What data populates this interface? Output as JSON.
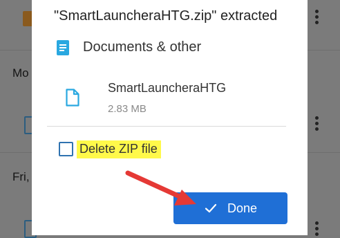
{
  "background": {
    "dates": [
      "Mo",
      "Fri,"
    ]
  },
  "dialog": {
    "title": "\"SmartLauncheraHTG.zip\" extracted",
    "section": {
      "label": "Documents & other",
      "icon": "document-icon"
    },
    "file": {
      "name": "SmartLauncheraHTG",
      "size": "2.83 MB",
      "icon": "file-icon"
    },
    "delete_option": {
      "label": "Delete ZIP file",
      "checked": false
    },
    "done_button": {
      "label": "Done",
      "icon": "check-icon"
    }
  },
  "annotation": {
    "arrow_color": "#e53935",
    "highlight_color": "#fff94a"
  },
  "colors": {
    "accent": "#1f6fd6",
    "doc_icon": "#29a8e0"
  }
}
